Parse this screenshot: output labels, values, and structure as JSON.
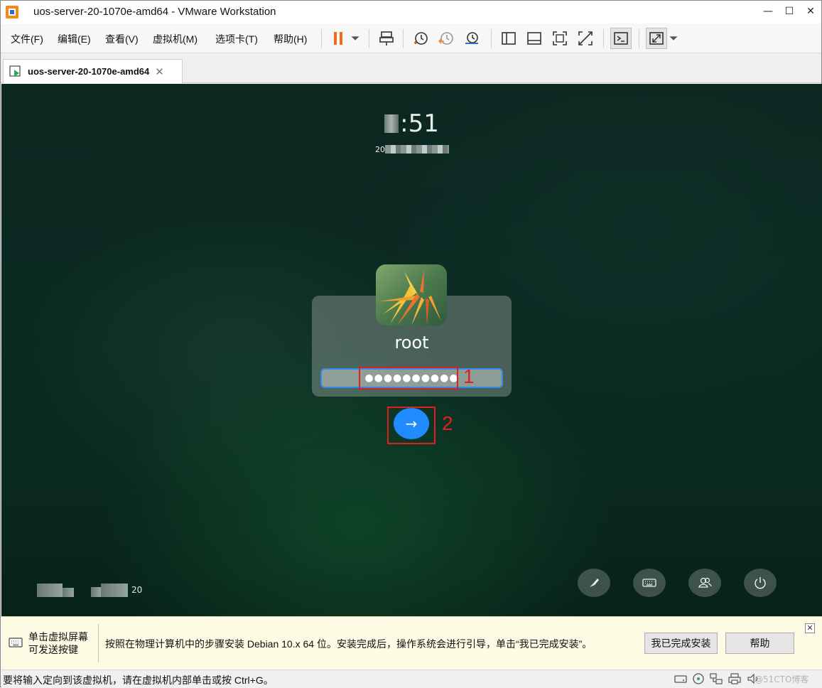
{
  "window": {
    "title": "uos-server-20-1070e-amd64 - VMware Workstation",
    "minimize": "—",
    "maximize": "☐",
    "close": "✕"
  },
  "menu": {
    "items": [
      "文件(F)",
      "编辑(E)",
      "查看(V)",
      "虚拟机(M)",
      "选项卡(T)",
      "帮助(H)"
    ]
  },
  "toolbar": {
    "icons": [
      "pause-icon",
      "dropdown-arrow-icon",
      "send-ctrl-alt-del-icon",
      "snapshot-take-icon",
      "snapshot-revert-icon",
      "snapshot-manager-icon",
      "view-sidebar-icon",
      "view-thumbnail-icon",
      "fullscreen-icon",
      "unity-icon",
      "console-icon",
      "stretch-icon"
    ]
  },
  "tab": {
    "label": "uos-server-20-1070e-amd64",
    "close": "✕"
  },
  "vm": {
    "clock_visible": ":51",
    "date_prefix": "20",
    "user": "root",
    "password_mask": "●●●●●●●●●●",
    "submit_glyph": "→",
    "annotations": [
      "1",
      "2"
    ],
    "bottom_left_num": "20",
    "bottom_buttons": [
      "keyboard-layout-icon",
      "keyboard-icon",
      "switch-user-icon",
      "power-icon"
    ]
  },
  "hint": {
    "left_line1": "单击虚拟屏幕",
    "left_line2": "可发送按键",
    "message": "按照在物理计算机中的步骤安装 Debian 10.x 64 位。安装完成后，操作系统会进行引导，单击“我已完成安装”。",
    "done_button": "我已完成安装",
    "help_button": "帮助",
    "close": "✕"
  },
  "status": {
    "text": "要将输入定向到该虚拟机，请在虚拟机内部单击或按 Ctrl+G。",
    "watermark": "@51CTO博客"
  },
  "colors": {
    "accent": "#1f8bff",
    "annotation": "#e02020",
    "pause": "#f26b1d"
  }
}
